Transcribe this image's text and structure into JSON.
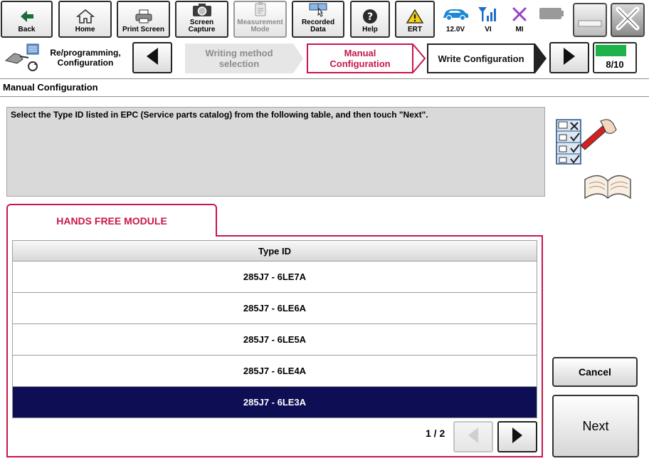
{
  "toolbar": {
    "buttons": [
      {
        "id": "back",
        "label": "Back",
        "icon": "back-arrow-icon"
      },
      {
        "id": "home",
        "label": "Home",
        "icon": "house-icon"
      },
      {
        "id": "print",
        "label": "Print Screen",
        "icon": "printer-icon"
      },
      {
        "id": "capture",
        "label_l1": "Screen",
        "label_l2": "Capture",
        "icon": "camera-icon"
      },
      {
        "id": "measurement",
        "label_l1": "Measurement",
        "label_l2": "Mode",
        "icon": "clipboard-icon",
        "disabled": true
      },
      {
        "id": "recorded",
        "label_l1": "Recorded",
        "label_l2": "Data",
        "icon": "recorded-data-icon"
      },
      {
        "id": "help",
        "label": "Help",
        "icon": "help-icon"
      },
      {
        "id": "ert",
        "label": "ERT",
        "icon": "warning-icon"
      }
    ],
    "status": [
      {
        "id": "battery",
        "label": "12.0V",
        "icon": "car-icon",
        "color": "#1e88d8"
      },
      {
        "id": "vi",
        "label": "VI",
        "icon": "signal-icon",
        "color": "#1e6fc8"
      },
      {
        "id": "mi",
        "label": "MI",
        "icon": "x-mark-icon",
        "color": "#9b3fc6"
      }
    ]
  },
  "stepbar": {
    "mode_label_l1": "Re/programming,",
    "mode_label_l2": "Configuration",
    "steps": [
      {
        "label_l1": "Writing method",
        "label_l2": "selection",
        "state": "done"
      },
      {
        "label_l1": "Manual",
        "label_l2": "Configuration",
        "state": "current"
      },
      {
        "label_l1": "Write Configuration",
        "state": "next"
      }
    ],
    "progress_text": "8/10",
    "progress_fraction": 0.8
  },
  "section_title": "Manual Configuration",
  "instruction": "Select the Type ID listed in EPC (Service parts catalog) from the following table, and then touch \"Next\".",
  "tab_label": "HANDS FREE MODULE",
  "table": {
    "header": "Type ID",
    "rows": [
      "285J7 - 6LE7A",
      "285J7 - 6LE6A",
      "285J7 - 6LE5A",
      "285J7 - 6LE4A",
      "285J7 - 6LE3A"
    ],
    "selected_index": 4
  },
  "pager": {
    "text": "1 / 2"
  },
  "actions": {
    "cancel": "Cancel",
    "next": "Next"
  },
  "colors": {
    "accent": "#c8174a",
    "selected_row": "#0e0e55",
    "progress": "#1db34a"
  }
}
